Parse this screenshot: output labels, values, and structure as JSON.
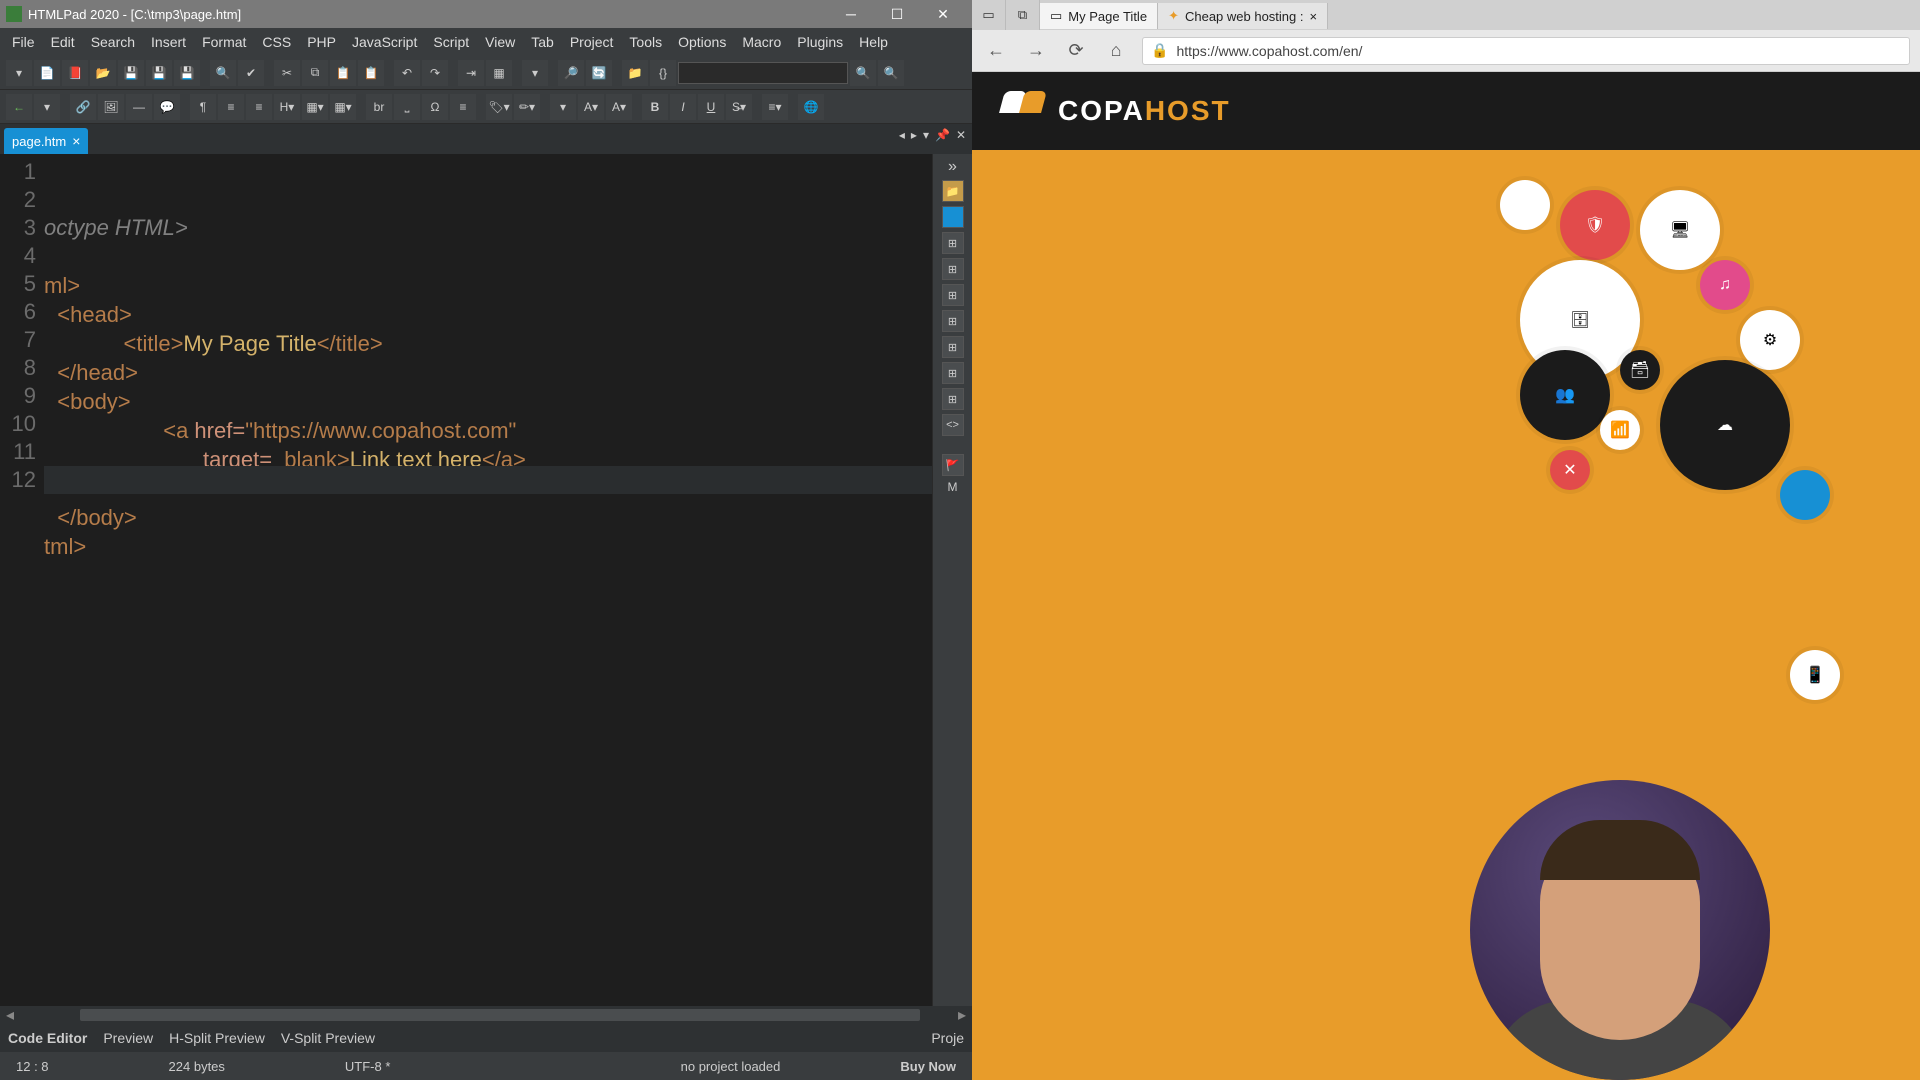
{
  "editor": {
    "titlebar": "HTMLPad 2020 - [C:\\tmp3\\page.htm]",
    "menu": [
      "File",
      "Edit",
      "Search",
      "Insert",
      "Format",
      "CSS",
      "PHP",
      "JavaScript",
      "Script",
      "View",
      "Tab",
      "Project",
      "Tools",
      "Options",
      "Macro",
      "Plugins",
      "Help"
    ],
    "tab_name": "page.htm",
    "gutter": [
      "1",
      "2",
      "3",
      "4",
      "5",
      "6",
      "7",
      "8",
      "9",
      "10",
      "11",
      "12"
    ],
    "code_lines": {
      "l1": "octype HTML>",
      "l2": "",
      "l3": "ml>",
      "l4_open": "<head>",
      "l5_open": "<title>",
      "l5_text": "My Page Title",
      "l5_close": "</title>",
      "l6": "</head>",
      "l7": "<body>",
      "l8_a": "<a ",
      "l8_href": "href=",
      "l8_url": "\"https://www.copahost.com\"",
      "l9_target": "target=",
      "l9_val": "_blank",
      "l9_gt": ">",
      "l9_text": "Link text here",
      "l9_close": "</a>",
      "l10": "",
      "l11": "</body>",
      "l12": "tml>"
    },
    "bottom_tabs": [
      "Code Editor",
      "Preview",
      "H-Split Preview",
      "V-Split Preview"
    ],
    "bottom_right": "Proje",
    "status": {
      "pos": "12 : 8",
      "bytes": "224 bytes",
      "enc": "UTF-8 *",
      "proj": "no project loaded",
      "buy": "Buy Now"
    },
    "side_label": "M"
  },
  "browser": {
    "tabs": [
      {
        "title": "My Page Title"
      },
      {
        "title": "Cheap web hosting :"
      }
    ],
    "url": "https://www.copahost.com/en/",
    "logo_a": "COPA",
    "logo_b": "HOST"
  }
}
